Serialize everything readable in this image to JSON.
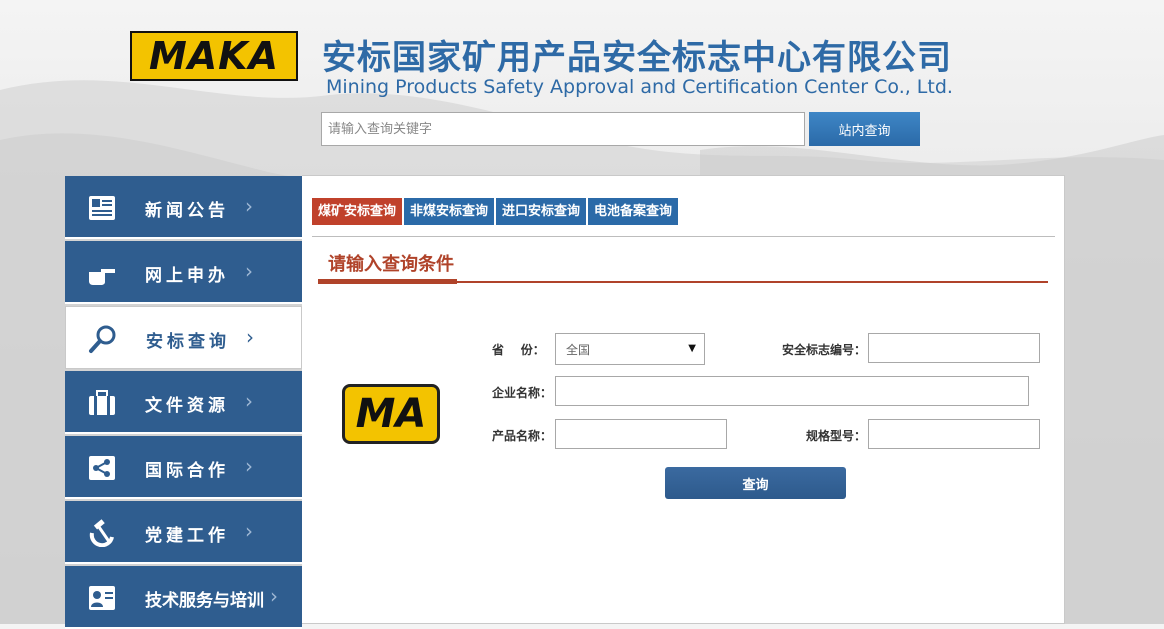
{
  "header": {
    "logo_text": "MAKA",
    "title_cn": "安标国家矿用产品安全标志中心有限公司",
    "title_en": "Mining Products Safety Approval and Certification Center Co., Ltd.",
    "search_placeholder": "请输入查询关键字",
    "search_button": "站内查询"
  },
  "sidebar": {
    "items": [
      {
        "label": "新闻公告",
        "icon": "news-icon"
      },
      {
        "label": "网上申办",
        "icon": "hand-pointer-icon"
      },
      {
        "label": "安标查询",
        "icon": "search-icon",
        "active": true
      },
      {
        "label": "文件资源",
        "icon": "briefcase-icon"
      },
      {
        "label": "国际合作",
        "icon": "share-icon"
      },
      {
        "label": "党建工作",
        "icon": "hammer-sickle-icon"
      },
      {
        "label": "技术服务与培训",
        "icon": "id-card-icon"
      }
    ]
  },
  "main": {
    "tabs": [
      {
        "label": "煤矿安标查询",
        "active": true
      },
      {
        "label": "非煤安标查询"
      },
      {
        "label": "进口安标查询"
      },
      {
        "label": "电池备案查询"
      }
    ],
    "section_title": "请输入查询条件",
    "logo_text": "MA",
    "form": {
      "province_label": "省    份：",
      "province_value": "全国",
      "safety_no_label": "安全标志编号：",
      "company_label": "企业名称：",
      "product_label": "产品名称：",
      "model_label": "规格型号：",
      "query_button": "查询"
    }
  },
  "colors": {
    "brand_blue": "#2f5d8f",
    "tab_blue": "#2b6aa8",
    "active_red": "#c0412b",
    "title_blue": "#2e6aa6",
    "logo_yellow": "#f3c300"
  }
}
